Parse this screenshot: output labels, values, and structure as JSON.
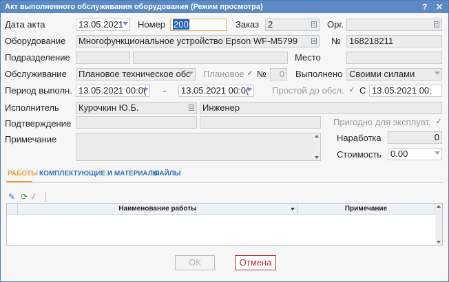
{
  "window": {
    "title": "Акт выполненного обслуживания оборудования (Режим просмотра)",
    "help": "?",
    "close": "✕"
  },
  "form": {
    "act_date_label": "Дата акта",
    "act_date": "13.05.2021",
    "number_label": "Номер",
    "number": "200",
    "order_label": "Заказ",
    "order": "2",
    "org_label": "Орг.",
    "org": "",
    "equipment_label": "Оборудование",
    "equipment": "Многофункциональное устройство Epson WF-M5799",
    "num_label": "№",
    "inv_number": "168218211",
    "division_label": "Подразделение",
    "division_code": "",
    "division_name": "",
    "place_label": "Место",
    "place": "",
    "service_label": "Обслуживание",
    "service": "Плановое техническое обс",
    "planned_label": "Плановое",
    "planned_checked": true,
    "planned_num_label": "№",
    "planned_num": "0",
    "done_label": "Выполнено",
    "done_by": "Своими силами",
    "period_label": "Период выполн.",
    "period_from": "13.05.2021 00:0(",
    "period_dash": "-",
    "period_to": "13.05.2021 00:0(",
    "downtime_label": "Простой до обсл.",
    "downtime_checked": true,
    "from_label": "С",
    "downtime_from": "13.05.2021 00:",
    "executor_label": "Исполнитель",
    "executor": "Курочкин Ю.Б.",
    "executor_role": "Инженер",
    "confirm_label": "Подтверждение",
    "confirm_code": "",
    "confirm_name": "",
    "fit_label": "Пригодно для эксплуат.",
    "fit_checked": true,
    "note_label": "Примечание",
    "note": "",
    "runtime_label": "Наработка",
    "runtime": "0",
    "cost_label": "Стоимость",
    "cost": "0.00"
  },
  "tabs": [
    {
      "label": "РАБОТЫ",
      "active": true
    },
    {
      "label": "КОМПЛЕКТУЮЩИЕ И МАТЕРИАЛЫ",
      "active": false
    },
    {
      "label": "ФАЙЛЫ",
      "active": false
    }
  ],
  "toolbar_icons": [
    "edit-icon",
    "refresh-icon",
    "magic-wand-icon"
  ],
  "grid": {
    "columns": [
      "Наименование работы",
      "Примечание"
    ],
    "rows": []
  },
  "buttons": {
    "ok": "ОК",
    "cancel": "Отмена"
  },
  "colors": {
    "titlebar": "#5b8ac4",
    "accent_tab": "#e89a2c",
    "link_tab": "#2a6fc0",
    "cancel": "#b3322c"
  }
}
